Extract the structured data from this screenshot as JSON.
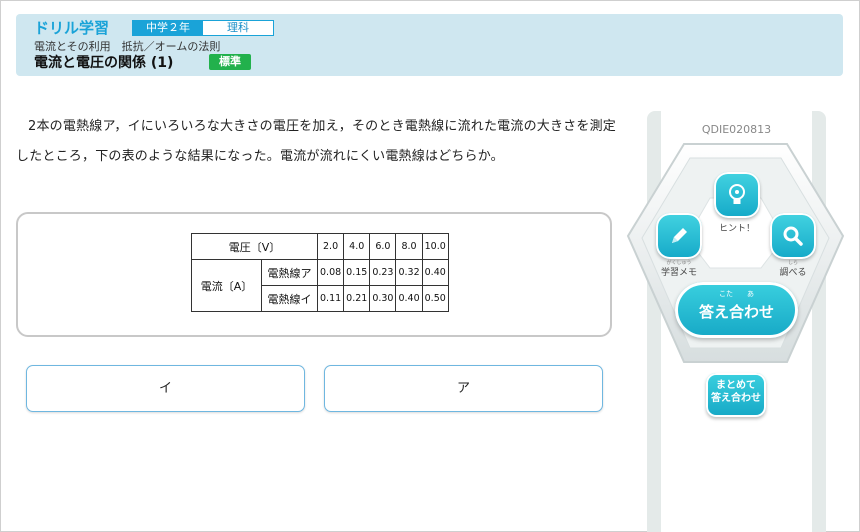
{
  "header": {
    "brand": "ドリル学習",
    "grade": "中学２年",
    "subject": "理科",
    "breadcrumb": "電流とその利用　抵抗／オームの法則",
    "title": "電流と電圧の関係 (1)",
    "level": "標準"
  },
  "question": {
    "text": "2本の電熱線ア，イにいろいろな大きさの電圧を加え，そのとき電熱線に流れた電流の大きさを測定したところ，下の表のような結果になった。電流が流れにくい電熱線はどちらか。"
  },
  "table": {
    "voltage_label": "電圧〔V〕",
    "voltages": [
      "2.0",
      "4.0",
      "6.0",
      "8.0",
      "10.0"
    ],
    "current_label": "電流〔A〕",
    "rows": [
      {
        "name": "電熱線ア",
        "values": [
          "0.08",
          "0.15",
          "0.23",
          "0.32",
          "0.40"
        ]
      },
      {
        "name": "電熱線イ",
        "values": [
          "0.11",
          "0.21",
          "0.30",
          "0.40",
          "0.50"
        ]
      }
    ]
  },
  "answers": [
    {
      "label": "イ"
    },
    {
      "label": "ア"
    }
  ],
  "side": {
    "question_id": "QDIE020813",
    "hint_label": "ヒント！",
    "memo_ruby": "がくしゅう",
    "memo_label": "学習メモ",
    "search_ruby": "しら",
    "search_label": "調べる",
    "submit_ruby": "こた　　あ",
    "submit_label": "答え合わせ",
    "submit_all_line1": "まとめて",
    "submit_all_line2": "答え合わせ",
    "accent": "#1aa3d8"
  }
}
